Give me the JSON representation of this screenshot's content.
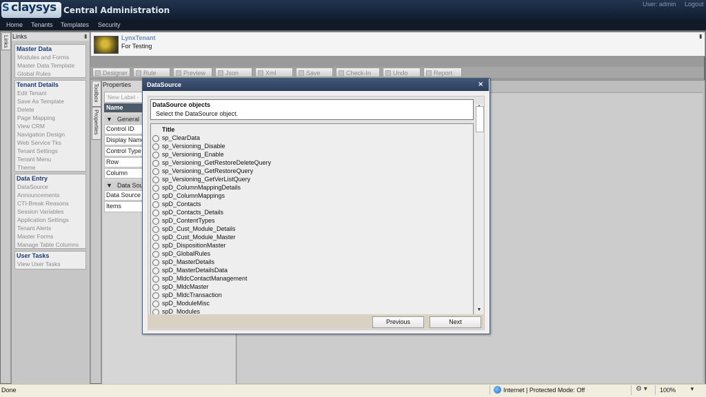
{
  "header": {
    "logo_s": "S",
    "logo_text": "claysys",
    "app_title": "Central Administration",
    "user_label": "User: admin",
    "logout_label": "Logout"
  },
  "menu": [
    "Home",
    "Tenants",
    "Templates",
    "Security"
  ],
  "links": {
    "tab_label": "Links",
    "title": "Links",
    "groups": [
      {
        "title": "Master Data",
        "items": [
          "Modules and Forms",
          "Master Data Template",
          "Global Rules"
        ]
      },
      {
        "title": "Tenant Details",
        "items": [
          "Edit Tenant",
          "Save As Template",
          "Delete",
          "Page Mapping",
          "View CRM",
          "Navigation Design",
          "Web Service Tks",
          "Tenant Settings",
          "Tenant Menu",
          "Theme"
        ]
      },
      {
        "title": "Data Entry",
        "items": [
          "DataSource",
          "Announcements",
          "CTI-Break Reasons",
          "Session Variables",
          "Application Settings",
          "Tenant Alerts",
          "Master Forms",
          "Manage Table Columns"
        ]
      },
      {
        "title": "User Tasks",
        "items": [
          "View User Tasks"
        ]
      }
    ]
  },
  "tenant": {
    "name": "LynxTenant",
    "description": "For Testing"
  },
  "toolbar": [
    "Designer",
    "Rule",
    "Preview",
    "Json",
    "Xml",
    "Save",
    "Check-In",
    "Undo",
    "Report"
  ],
  "side_tabs": [
    "Toolbox",
    "Properties"
  ],
  "properties": {
    "title": "Properties",
    "select_value": "New Label -",
    "grid_header": "Name",
    "category_general": "General",
    "general_rows": [
      "Control ID",
      "Display Name",
      "Control Type",
      "Row",
      "Column"
    ],
    "category_datasource": "Data Sou",
    "datasource_rows": [
      "Data Source",
      "Items"
    ]
  },
  "dialog": {
    "title": "DataSource",
    "close": "×",
    "info_title": "DataSource objects",
    "info_desc": "Select the  DataSource object.",
    "list_header": "Title",
    "options": [
      "sp_ClearData",
      "sp_Versioning_Disable",
      "sp_Versioning_Enable",
      "sp_Versioning_GetRestoreDeleteQuery",
      "sp_Versioning_GetRestoreQuery",
      "sp_Versioning_GetVerListQuery",
      "spD_ColumnMappingDetails",
      "spD_ColumnMappings",
      "spD_Contacts",
      "spD_Contacts_Details",
      "spD_ContentTypes",
      "spD_Cust_Module_Details",
      "spD_Cust_Module_Master",
      "spD_DispositionMaster",
      "spD_GlobalRules",
      "spD_MasterDetails",
      "spD_MasterDetailsData",
      "spD_MldcContactManagement",
      "spD_MldcMaster",
      "spD_MldcTransaction",
      "spD_ModuleMisc",
      "spD_Modules"
    ],
    "previous_label": "Previous",
    "next_label": "Next",
    "scroll_up": "▲",
    "scroll_down": "▼"
  },
  "statusbar": {
    "text": "Done",
    "zone": "Internet | Protected Mode: Off",
    "tools": "⚙ ▾",
    "zoom": "100%",
    "zoom_arrow": "▼"
  },
  "colors": {
    "header": "#1a2740",
    "dialog_title": "#354a6c",
    "group_title": "#1d3b78"
  }
}
